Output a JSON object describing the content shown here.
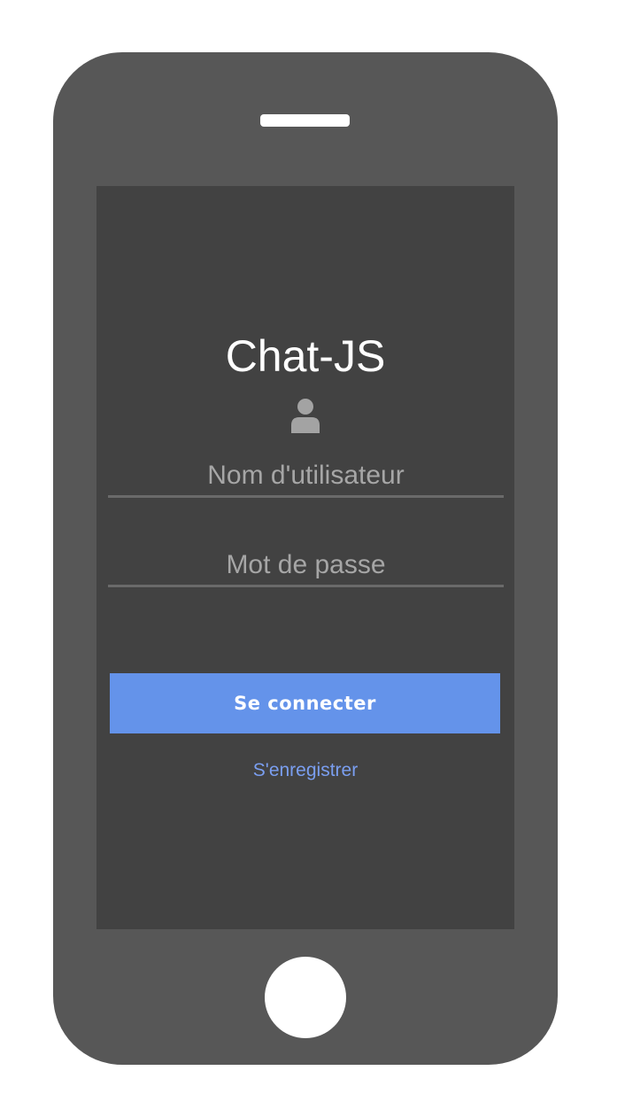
{
  "app": {
    "title": "Chat-JS"
  },
  "login_form": {
    "username": {
      "placeholder": "Nom d'utilisateur",
      "value": "",
      "icon": "user-icon"
    },
    "password": {
      "placeholder": "Mot de passe",
      "value": ""
    },
    "submit_label": "Se connecter",
    "register_label": "S'enregistrer"
  },
  "colors": {
    "phone_body": "#575757",
    "screen_background": "#424242",
    "primary_button": "#6493ea",
    "link": "#7a9ef0",
    "placeholder_text": "#a6a6a6"
  }
}
